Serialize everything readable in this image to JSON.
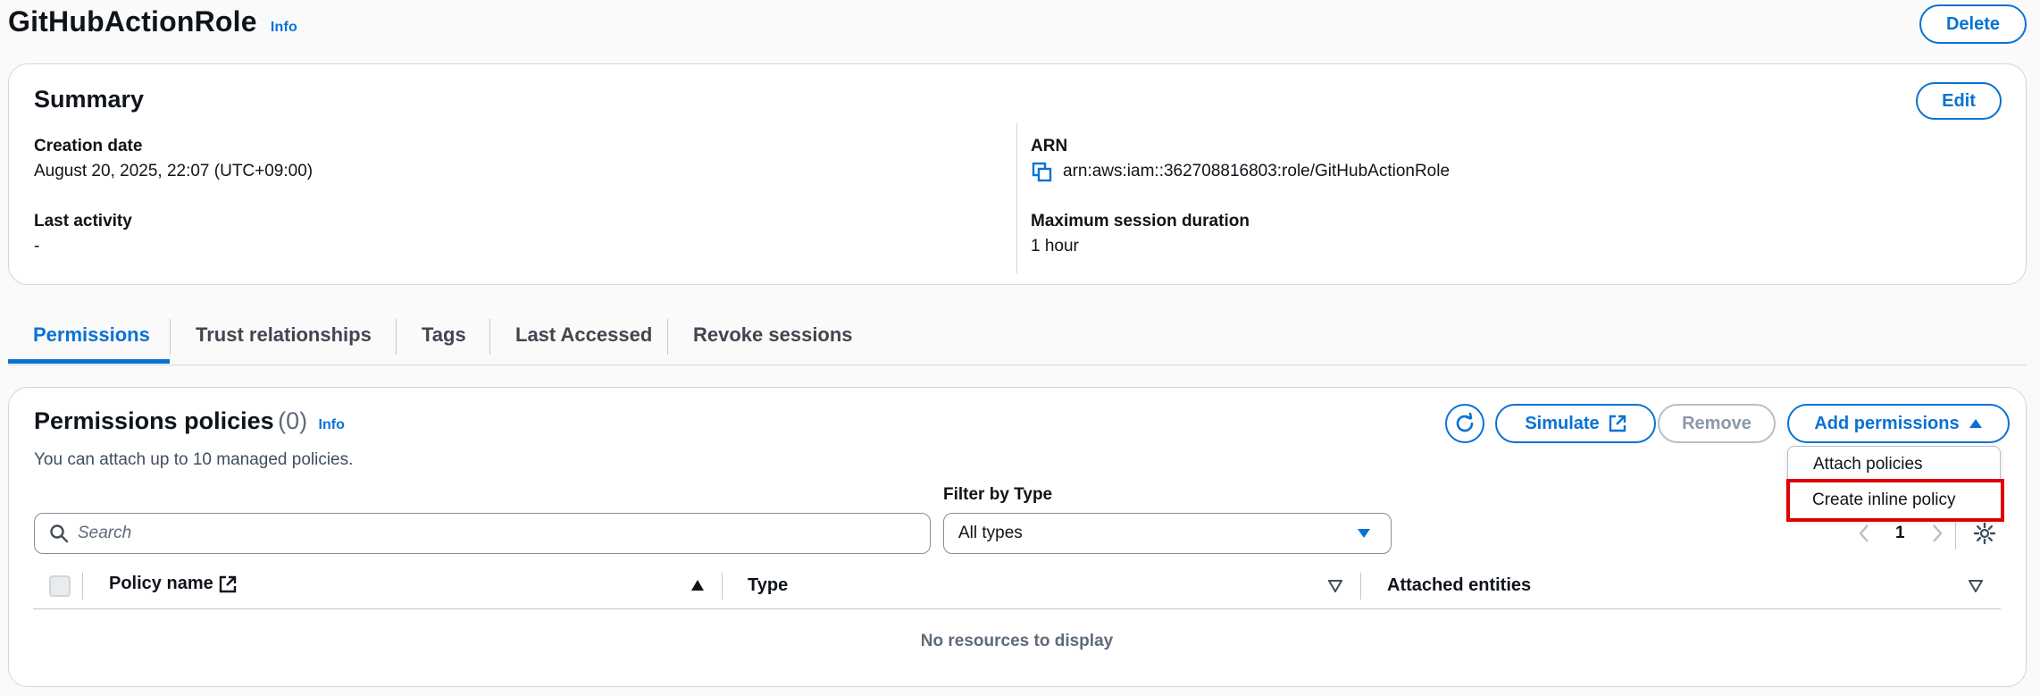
{
  "header": {
    "title": "GitHubActionRole",
    "info": "Info",
    "delete_label": "Delete"
  },
  "summary": {
    "title": "Summary",
    "edit_label": "Edit",
    "creation_date_label": "Creation date",
    "creation_date_value": "August 20, 2025, 22:07 (UTC+09:00)",
    "last_activity_label": "Last activity",
    "last_activity_value": "-",
    "arn_label": "ARN",
    "arn_value": "arn:aws:iam::362708816803:role/GitHubActionRole",
    "max_session_label": "Maximum session duration",
    "max_session_value": "1 hour"
  },
  "tabs": [
    {
      "label": "Permissions",
      "active": true
    },
    {
      "label": "Trust relationships"
    },
    {
      "label": "Tags"
    },
    {
      "label": "Last Accessed"
    },
    {
      "label": "Revoke sessions"
    }
  ],
  "policies": {
    "title": "Permissions policies",
    "count": "(0)",
    "info": "Info",
    "description": "You can attach up to 10 managed policies.",
    "simulate_label": "Simulate",
    "remove_label": "Remove",
    "add_permissions_label": "Add permissions",
    "search_placeholder": "Search",
    "filter_label": "Filter by Type",
    "filter_value": "All types",
    "page": "1",
    "columns": [
      "Policy name",
      "Type",
      "Attached entities"
    ],
    "empty_text": "No resources to display"
  },
  "menu": {
    "items": [
      "Attach policies",
      "Create inline policy"
    ],
    "highlighted_index": 1
  },
  "colors": {
    "accent": "#0972d3",
    "highlight": "#e00000"
  }
}
